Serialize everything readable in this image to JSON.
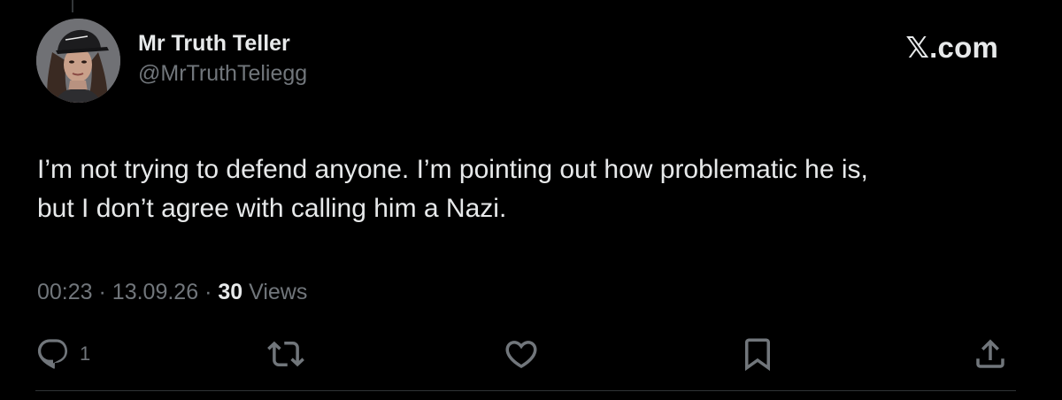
{
  "post": {
    "author": {
      "display_name": "Mr Truth Teller",
      "handle": "@MrTruthTeliegg",
      "avatar_icon": "profile-photo-avatar"
    },
    "brand_watermark": "𝕏.com",
    "text_lines": [
      "I’m not trying to defend anyone. I’m pointing out how problematic he is,",
      "but I don’t agree with calling him a Nazi."
    ],
    "meta": {
      "time": "00:23",
      "separator": "·",
      "date": "13.09.26",
      "views_count": "30",
      "views_label": "Views"
    },
    "actions": {
      "reply": {
        "icon": "reply-icon",
        "count": "1"
      },
      "repost": {
        "icon": "repost-icon"
      },
      "like": {
        "icon": "heart-icon"
      },
      "bookmark": {
        "icon": "bookmark-icon"
      },
      "share": {
        "icon": "share-icon"
      }
    }
  },
  "colors": {
    "background": "#000000",
    "primary_text": "#e7e9ea",
    "secondary_text": "#71767b",
    "divider": "#2f3336"
  }
}
